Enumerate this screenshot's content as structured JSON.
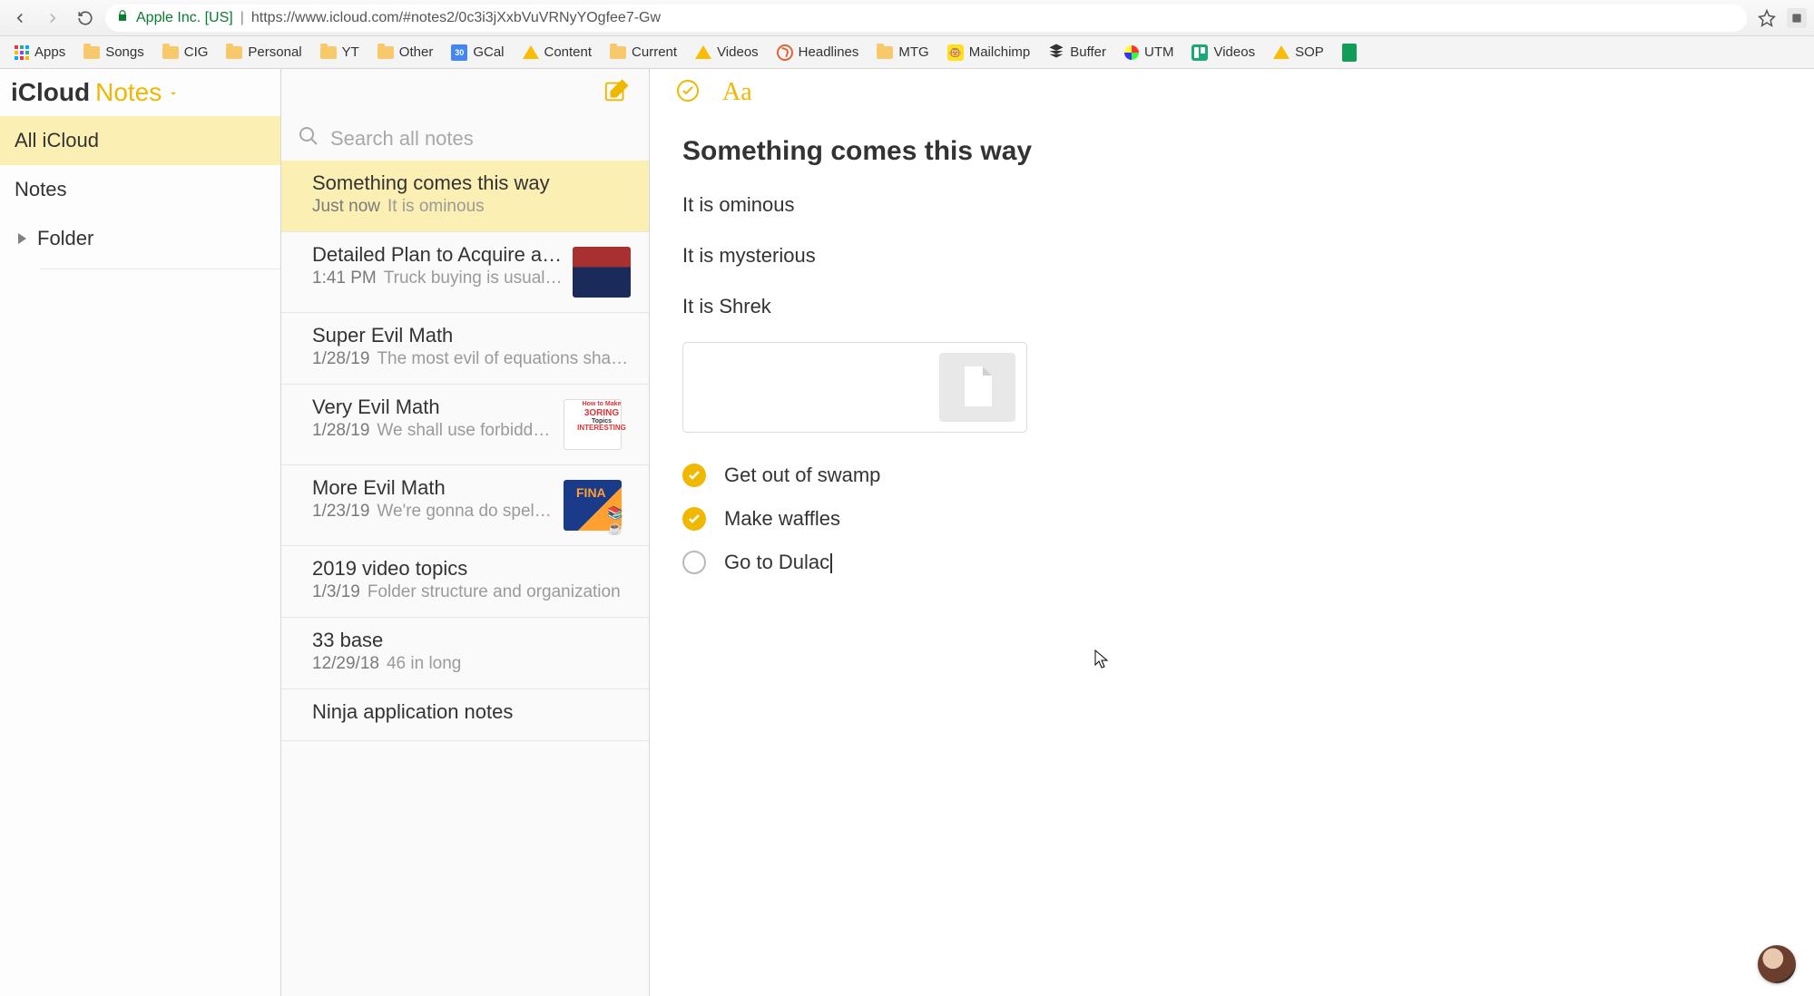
{
  "browser": {
    "identity": "Apple Inc. [US]",
    "url": "https://www.icloud.com/#notes2/0c3i3jXxbVuVRNyYOgfee7-Gw"
  },
  "bookmarks": [
    {
      "label": "Apps",
      "kind": "apps"
    },
    {
      "label": "Songs",
      "kind": "folder"
    },
    {
      "label": "CIG",
      "kind": "folder"
    },
    {
      "label": "Personal",
      "kind": "folder"
    },
    {
      "label": "YT",
      "kind": "folder"
    },
    {
      "label": "Other",
      "kind": "folder"
    },
    {
      "label": "GCal",
      "kind": "gcal",
      "badge": "30"
    },
    {
      "label": "Content",
      "kind": "gdrive"
    },
    {
      "label": "Current",
      "kind": "folder"
    },
    {
      "label": "Videos",
      "kind": "gdrive"
    },
    {
      "label": "Headlines",
      "kind": "headlines"
    },
    {
      "label": "MTG",
      "kind": "folder"
    },
    {
      "label": "Mailchimp",
      "kind": "mailchimp"
    },
    {
      "label": "Buffer",
      "kind": "buffer"
    },
    {
      "label": "UTM",
      "kind": "utm"
    },
    {
      "label": "Videos",
      "kind": "trello"
    },
    {
      "label": "SOP",
      "kind": "gdrive"
    },
    {
      "label": "",
      "kind": "sheets"
    }
  ],
  "app": {
    "title_icloud": "iCloud",
    "title_notes": "Notes"
  },
  "nav": {
    "all": "All iCloud",
    "notes": "Notes",
    "folder": "Folder"
  },
  "search": {
    "placeholder": "Search all notes"
  },
  "notes": [
    {
      "title": "Something comes this way",
      "time": "Just now",
      "preview": "It is ominous",
      "thumb": "",
      "selected": true
    },
    {
      "title": "Detailed Plan to Acquire a F…",
      "time": "1:41 PM",
      "preview": "Truck buying is usually …",
      "thumb": "spiderman"
    },
    {
      "title": "Super Evil Math",
      "time": "1/28/19",
      "preview": "The most evil of equations shal…",
      "thumb": ""
    },
    {
      "title": "Very Evil Math",
      "time": "1/28/19",
      "preview": "We shall use forbidden …",
      "thumb": "boring"
    },
    {
      "title": "More Evil Math",
      "time": "1/23/19",
      "preview": "We're gonna do spells, …",
      "thumb": "final"
    },
    {
      "title": "2019 video topics",
      "time": "1/3/19",
      "preview": "Folder structure and organization",
      "thumb": ""
    },
    {
      "title": "33 base",
      "time": "12/29/18",
      "preview": "46 in long",
      "thumb": ""
    },
    {
      "title": "Ninja application notes",
      "time": "",
      "preview": "",
      "thumb": ""
    }
  ],
  "editor": {
    "title": "Something comes this way",
    "paragraphs": [
      "It is ominous",
      "It is mysterious",
      "It is Shrek"
    ],
    "checklist": [
      {
        "label": "Get out of swamp",
        "checked": true
      },
      {
        "label": "Make waffles",
        "checked": true
      },
      {
        "label": "Go to Dulac",
        "checked": false,
        "cursor": true
      }
    ]
  }
}
